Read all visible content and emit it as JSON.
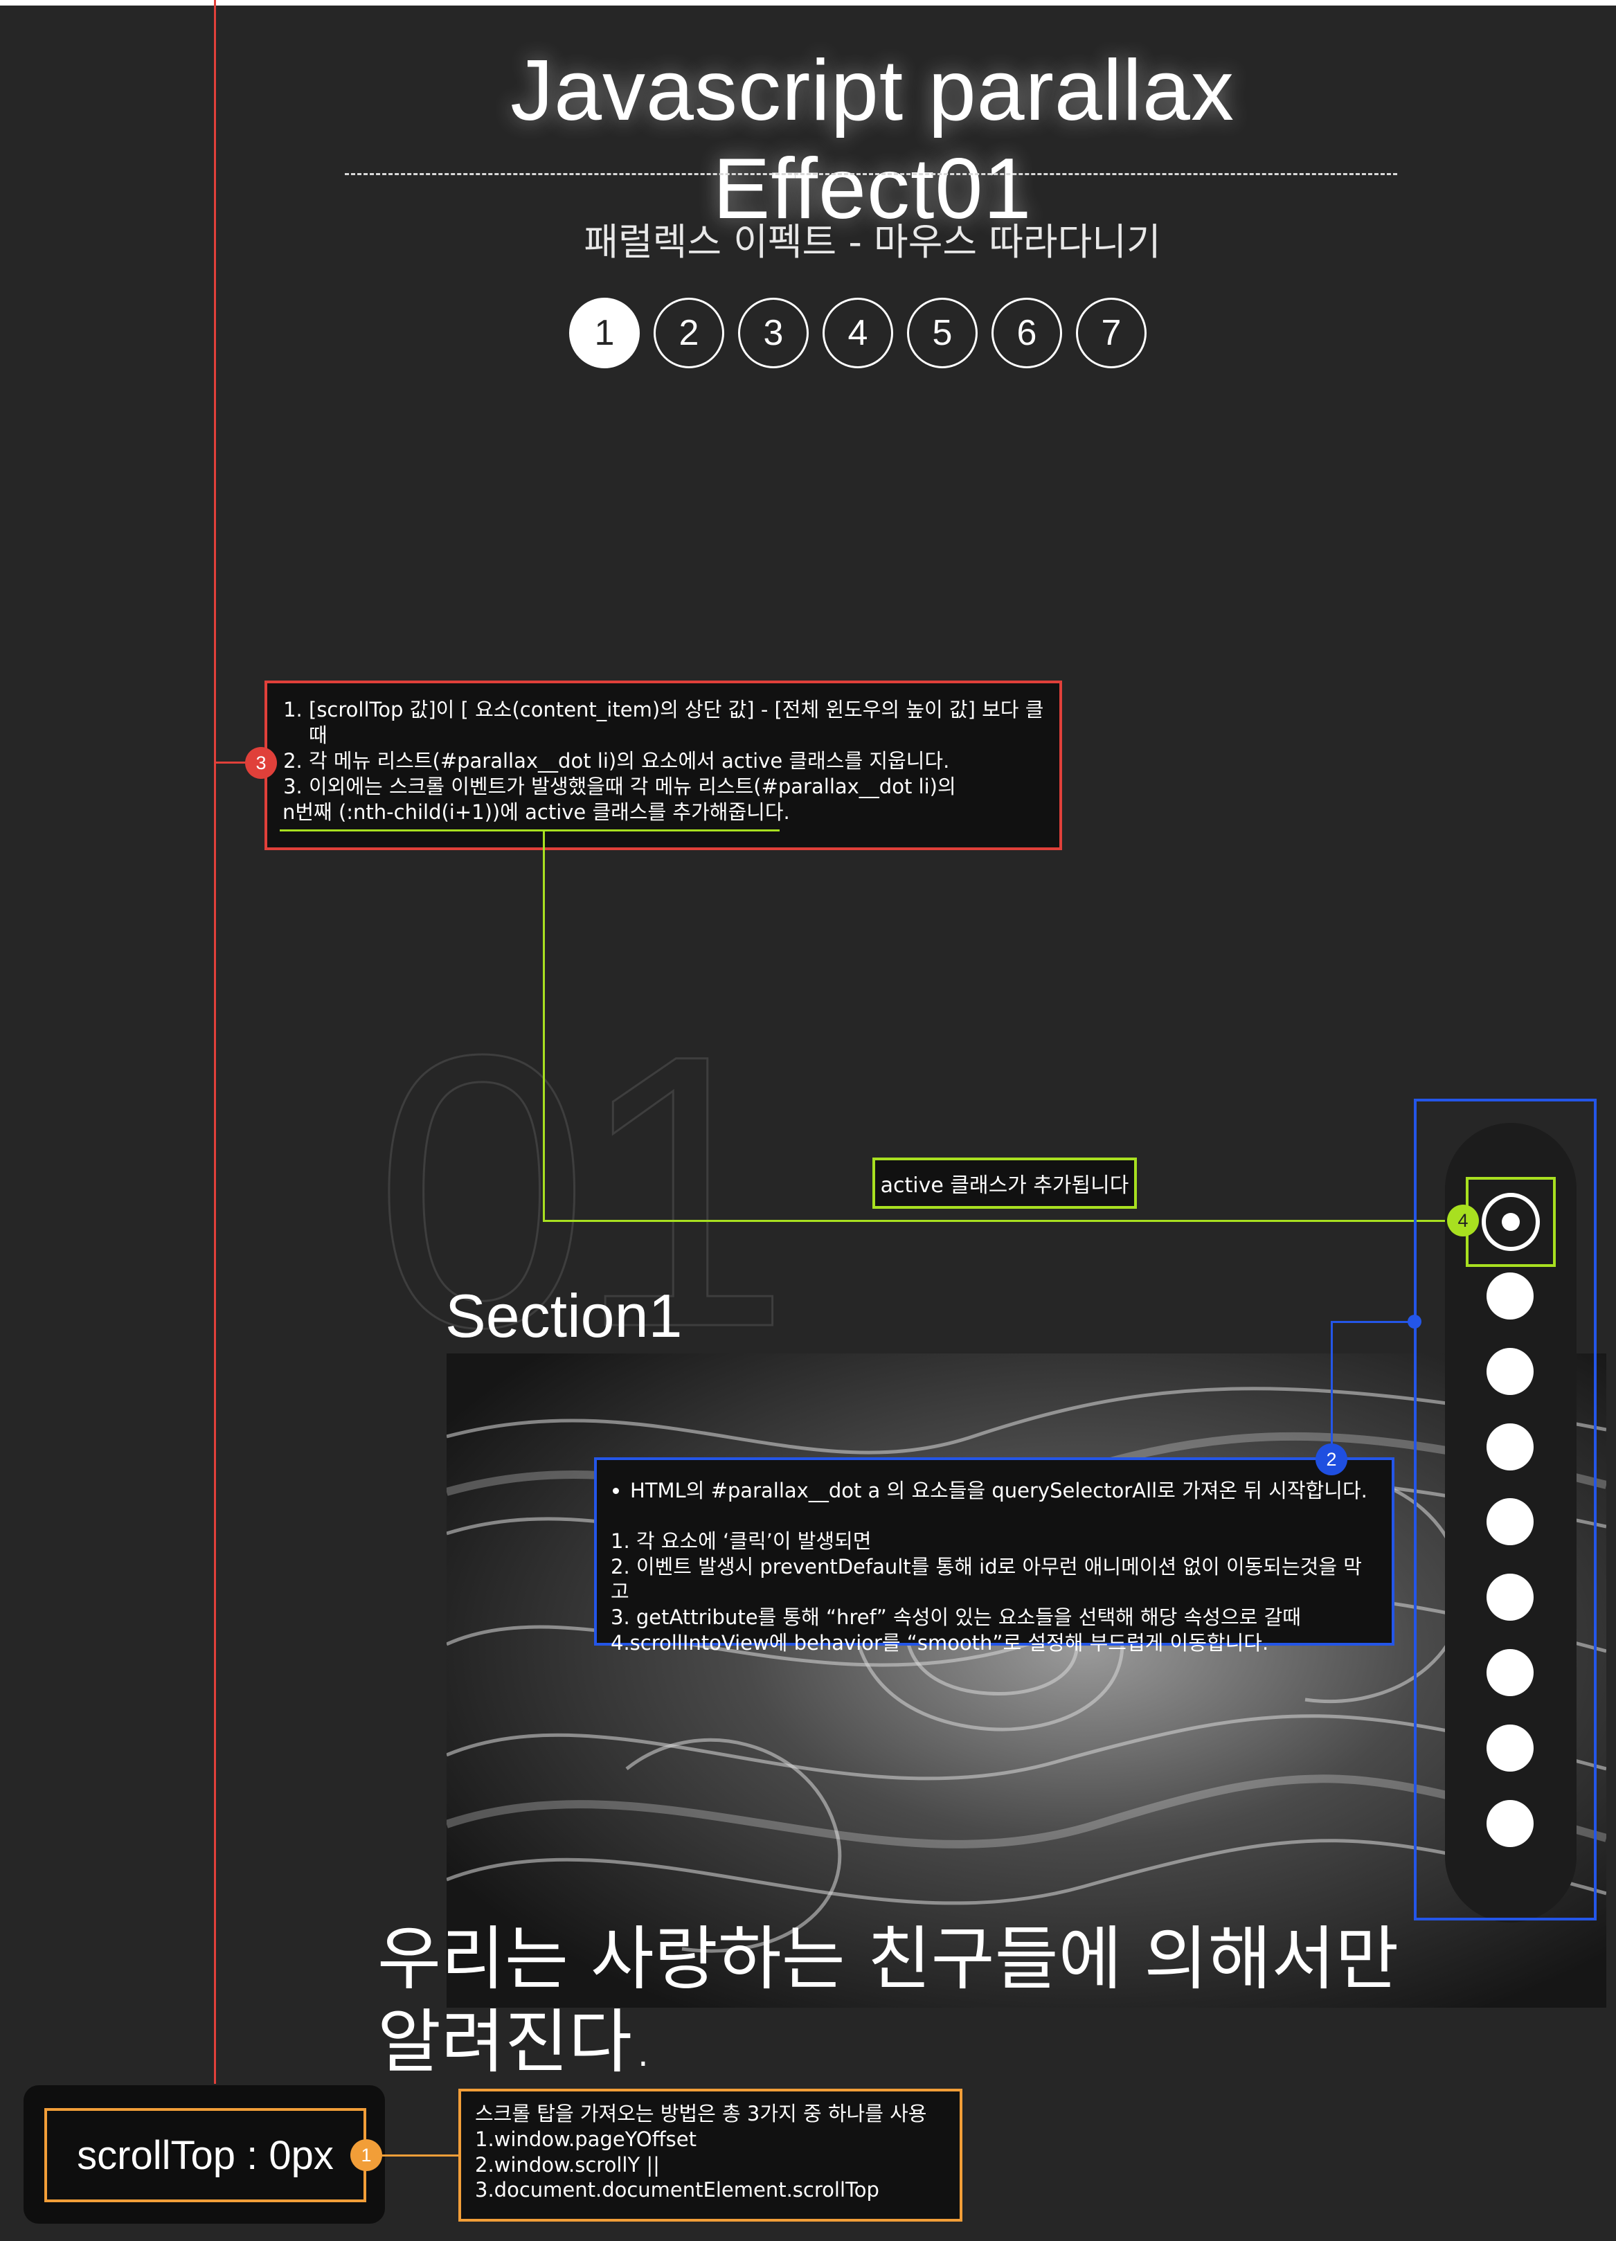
{
  "header": {
    "title": "Javascript parallax Effect01",
    "subtitle": "패럴렉스 이펙트 - 마우스 따라다니기"
  },
  "nav": {
    "items": [
      "1",
      "2",
      "3",
      "4",
      "5",
      "6",
      "7"
    ],
    "active_index": 0
  },
  "section": {
    "background_number": "01",
    "title": "Section1",
    "quote_line1": "우리는 사랑하는 친구들에 의해서만",
    "quote_line2": "알려진다."
  },
  "annotations": {
    "note3": {
      "badge": "3",
      "item1": "[scrollTop 값]이 [ 요소(content_item)의 상단 값] - [전체 윈도우의 높이 값] 보다 클 때",
      "item2": "각 메뉴 리스트(#parallax__dot li)의 요소에서 active 클래스를 지웁니다.",
      "item3": "이외에는 스크롤 이벤트가 발생했을때 각 메뉴 리스트(#parallax__dot li)의",
      "item3_cont": "n번째 (:nth-child(i+1))에 active 클래스를 추가해줍니다."
    },
    "note4": {
      "badge": "4",
      "text": "active 클래스가 추가됩니다"
    },
    "note2": {
      "badge": "2",
      "bullet": "HTML의 #parallax__dot a 의 요소들을 querySelectorAll로 가져온 뒤 시작합니다.",
      "line1": "1. 각 요소에 ‘클릭’이 발생되면",
      "line2": "2. 이벤트 발생시 preventDefault를 통해 id로 아무런 애니메이션 없이 이동되는것을 막고",
      "line3": "3. getAttribute를 통해 “href” 속성이 있는 요소들을 선택해 해당 속성으로 갈때",
      "line4": "4.scrollIntoView에 behavior를 “smooth”로 설정해 부드럽게 이동합니다."
    },
    "note1": {
      "badge": "1",
      "line1": "스크롤 탑을 가져오는 방법은 총 3가지 중 하나를 사용",
      "line2": "1.window.pageYOffset",
      "line3": "2.window.scrollY ||",
      "line4": "3.document.documentElement.scrollTop"
    }
  },
  "scroll_indicator": {
    "text": "scrollTop : 0px"
  },
  "side_nav": {
    "dot_count": 9,
    "active_index": 0
  },
  "colors": {
    "background": "#262626",
    "annotation_red": "#e0403a",
    "annotation_green": "#a8e020",
    "annotation_blue": "#2456e8",
    "annotation_orange": "#f29e38"
  }
}
